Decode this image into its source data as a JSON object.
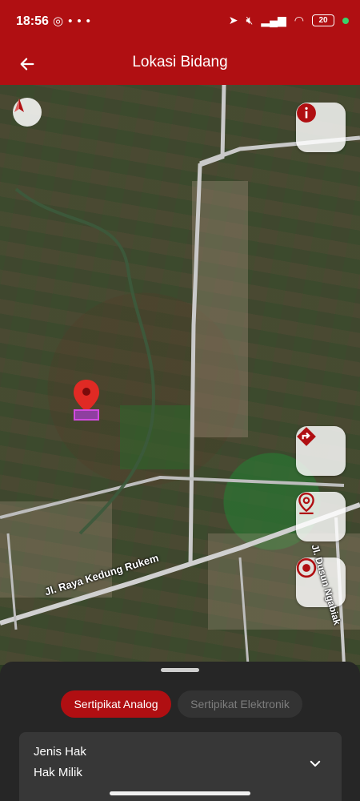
{
  "status_bar": {
    "time": "18:56",
    "battery": "20",
    "left_icons": [
      "whatsapp-icon",
      "more-dots-icon"
    ],
    "right_icons": [
      "location-arrow-icon",
      "mute-icon",
      "signal-icon",
      "wifi-icon",
      "battery-icon"
    ]
  },
  "app_bar": {
    "title": "Lokasi Bidang",
    "back_icon": "arrow-left-icon"
  },
  "map": {
    "road_label_1": "Jl. Raya Kedung Rukem",
    "road_label_2": "Jl. Dusun Ngabiak",
    "buttons": [
      "info-icon",
      "directions-icon",
      "location-pin-icon",
      "my-location-icon"
    ]
  },
  "sheet": {
    "tabs": [
      {
        "label": "Sertipikat Analog",
        "active": true
      },
      {
        "label": "Sertipikat Elektronik",
        "active": false
      }
    ],
    "card": {
      "label": "Jenis Hak",
      "value": "Hak Milik"
    }
  },
  "colors": {
    "primary": "#b00f12",
    "sheet_bg": "#262626",
    "card_bg": "#373737"
  }
}
